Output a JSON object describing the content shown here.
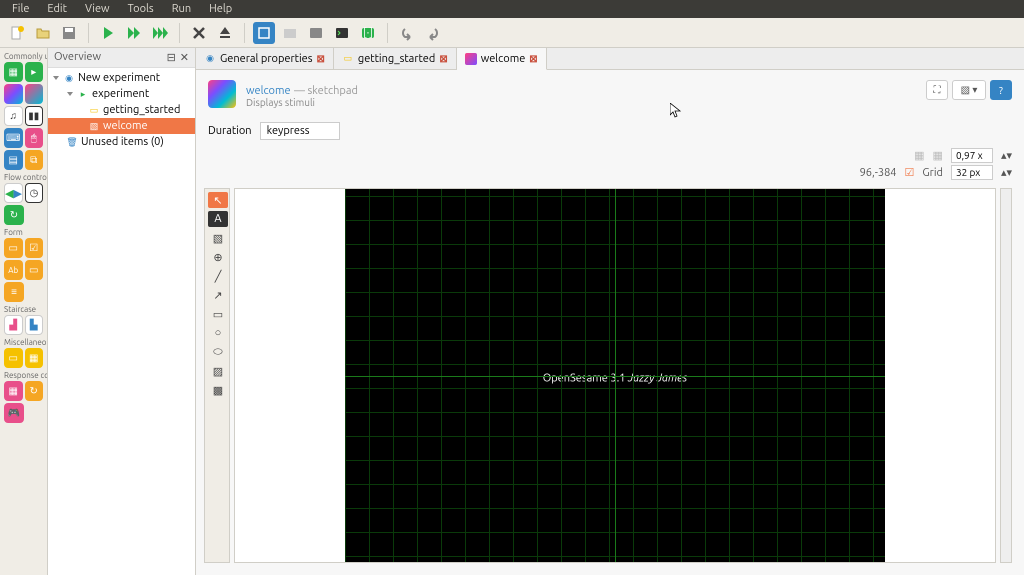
{
  "menu": {
    "file": "File",
    "edit": "Edit",
    "view": "View",
    "tools": "Tools",
    "run": "Run",
    "help": "Help"
  },
  "sidebar": {
    "commonly_used": "Commonly used",
    "flow_control": "Flow control",
    "form": "Form",
    "staircase": "Staircase",
    "misc": "Miscellaneous",
    "response": "Response collection"
  },
  "overview": {
    "title": "Overview",
    "tree": {
      "root": "New experiment",
      "seq": "experiment",
      "gs": "getting_started",
      "welcome": "welcome",
      "unused": "Unused items (0)"
    }
  },
  "tabs": {
    "general": "General properties",
    "getting_started": "getting_started",
    "welcome": "welcome"
  },
  "item": {
    "name": "welcome",
    "type": "sketchpad",
    "desc": "Displays stimuli"
  },
  "duration": {
    "label": "Duration",
    "value": "keypress"
  },
  "zoom": {
    "value": "0,97 x",
    "coords": "96,-384",
    "grid_label": "Grid",
    "grid_value": "32 px"
  },
  "sketchpad": {
    "text_plain": "OpenSesame 3.1 ",
    "text_italic": "Jazzy James"
  }
}
